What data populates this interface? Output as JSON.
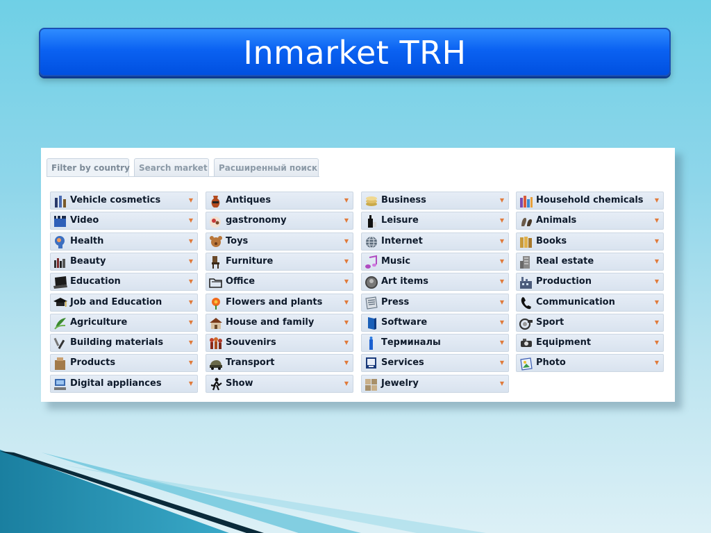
{
  "title": "Inmarket TRH",
  "tabs": [
    {
      "label": "Filter by country"
    },
    {
      "label": "Search market"
    },
    {
      "label": "Расширенный поиск"
    }
  ],
  "columns": [
    [
      {
        "label": "Vehicle cosmetics",
        "icon": "bottles-icon"
      },
      {
        "label": "Video",
        "icon": "clapperboard-icon"
      },
      {
        "label": "Health",
        "icon": "head-icon"
      },
      {
        "label": "Beauty",
        "icon": "cosmetics-icon"
      },
      {
        "label": "Education",
        "icon": "laptop-icon"
      },
      {
        "label": "Job and Education",
        "icon": "graduation-cap-icon"
      },
      {
        "label": "Agriculture",
        "icon": "plant-icon"
      },
      {
        "label": "Building materials",
        "icon": "tools-icon"
      },
      {
        "label": "Products",
        "icon": "bag-icon"
      },
      {
        "label": "Digital appliances",
        "icon": "computer-icon"
      }
    ],
    [
      {
        "label": "Antiques",
        "icon": "vase-icon"
      },
      {
        "label": "gastronomy",
        "icon": "food-icon"
      },
      {
        "label": "Toys",
        "icon": "teddy-bear-icon"
      },
      {
        "label": "Furniture",
        "icon": "chair-icon"
      },
      {
        "label": "Office",
        "icon": "folder-icon"
      },
      {
        "label": "Flowers and plants",
        "icon": "flower-icon"
      },
      {
        "label": "House and family",
        "icon": "house-icon"
      },
      {
        "label": "Souvenirs",
        "icon": "figurines-icon"
      },
      {
        "label": "Transport",
        "icon": "car-icon"
      },
      {
        "label": "Show",
        "icon": "dancer-icon"
      }
    ],
    [
      {
        "label": "Business",
        "icon": "stack-icon"
      },
      {
        "label": "Leisure",
        "icon": "bottle-icon"
      },
      {
        "label": "Internet",
        "icon": "globe-icon"
      },
      {
        "label": "Music",
        "icon": "music-note-icon"
      },
      {
        "label": "Art items",
        "icon": "coin-icon"
      },
      {
        "label": "Press",
        "icon": "newspaper-icon"
      },
      {
        "label": "Software",
        "icon": "software-box-icon"
      },
      {
        "label": "Терминалы",
        "icon": "terminal-icon"
      },
      {
        "label": "Services",
        "icon": "monitor-icon"
      },
      {
        "label": "Jewelry",
        "icon": "jewelry-icon"
      }
    ],
    [
      {
        "label": "Household chemicals",
        "icon": "chemicals-icon"
      },
      {
        "label": "Animals",
        "icon": "animals-icon"
      },
      {
        "label": "Books",
        "icon": "books-icon"
      },
      {
        "label": "Real estate",
        "icon": "building-icon"
      },
      {
        "label": "Production",
        "icon": "factory-icon"
      },
      {
        "label": "Communication",
        "icon": "phone-icon"
      },
      {
        "label": "Sport",
        "icon": "whistle-icon"
      },
      {
        "label": "Equipment",
        "icon": "equipment-icon"
      },
      {
        "label": "Photo",
        "icon": "photo-icon"
      }
    ]
  ],
  "colors": {
    "title_bar": "#0b62f2",
    "background": "#8fd6ea",
    "category_bg": "#e0e8f2",
    "dropdown_arrow": "#e07a3a"
  }
}
